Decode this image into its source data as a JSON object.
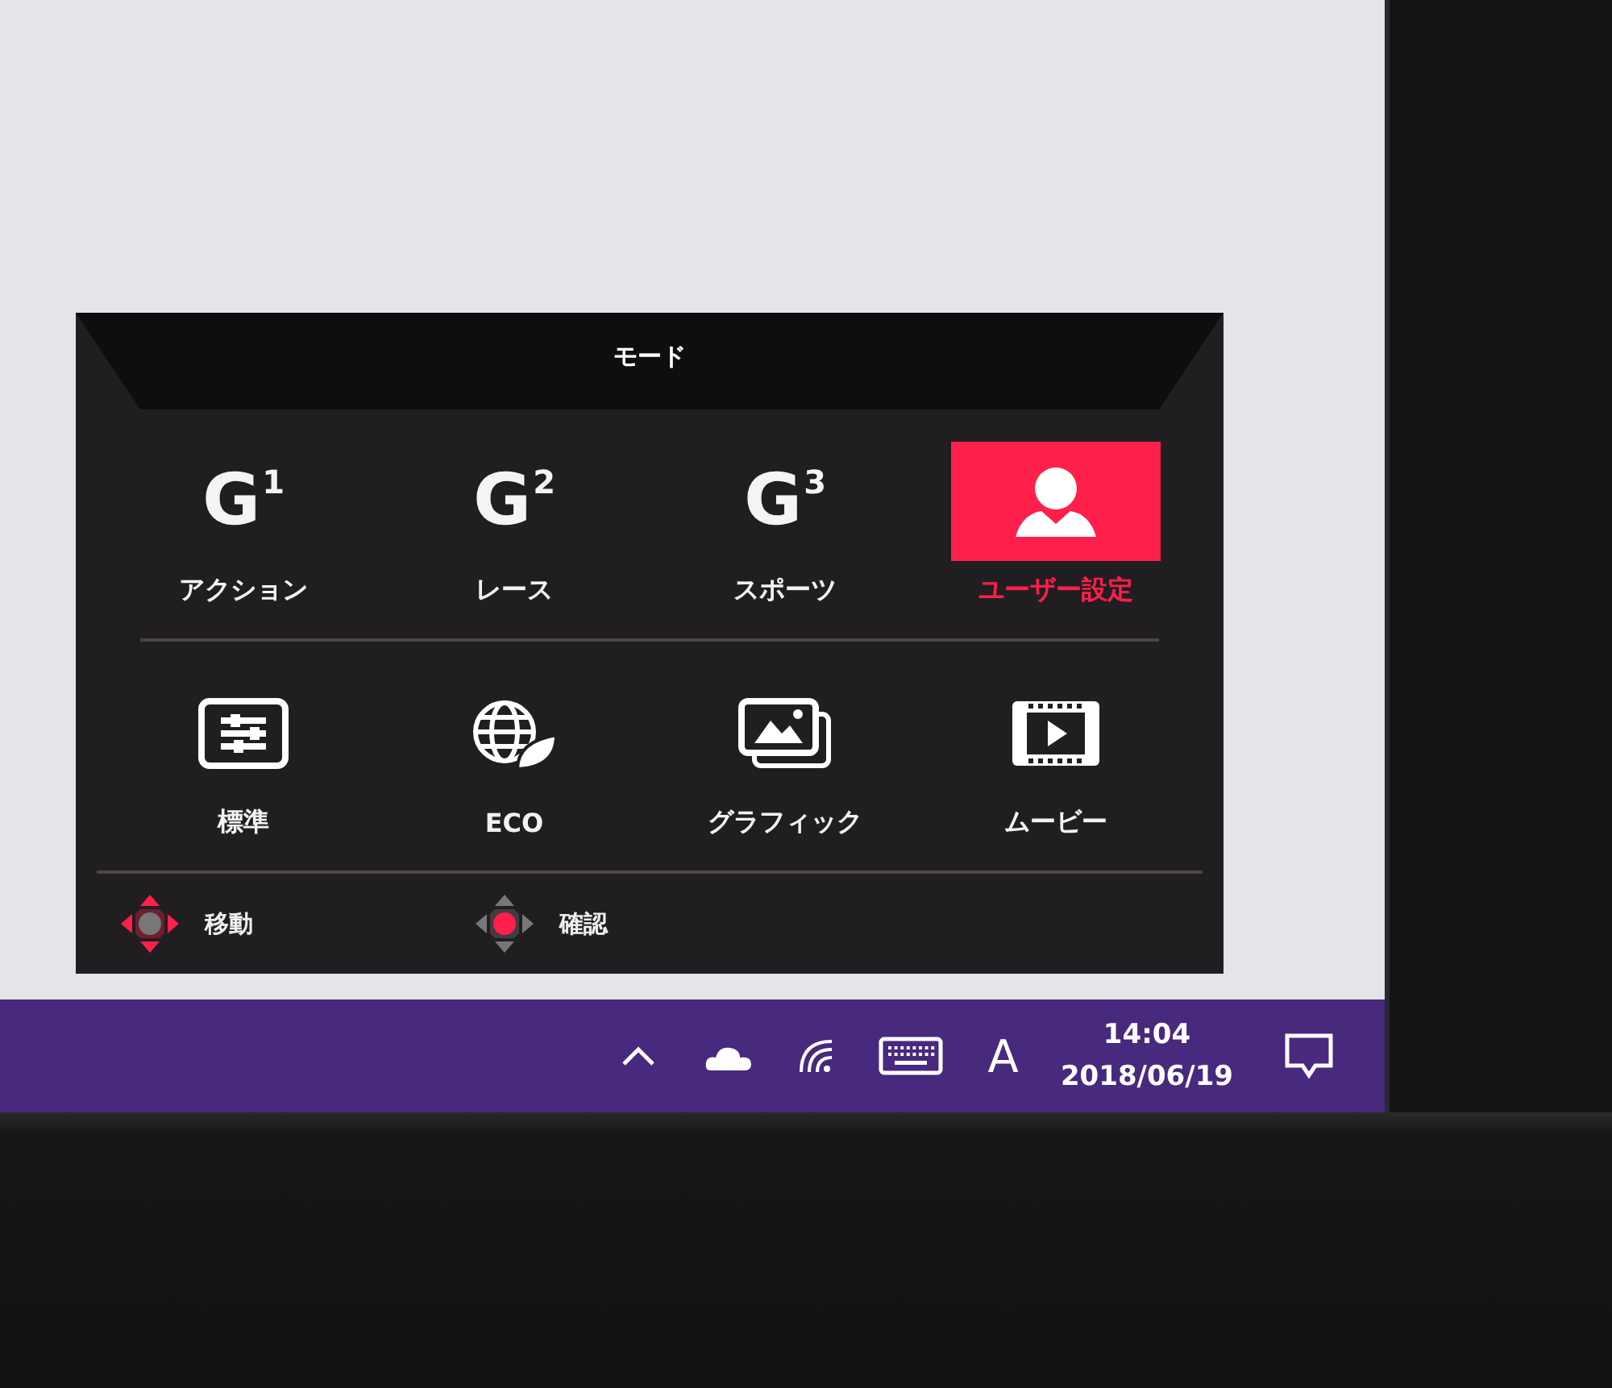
{
  "osd": {
    "title": "モード",
    "modes": [
      {
        "kind": "game",
        "badge": "G",
        "number": "1",
        "label": "アクション",
        "selected": false
      },
      {
        "kind": "game",
        "badge": "G",
        "number": "2",
        "label": "レース",
        "selected": false
      },
      {
        "kind": "game",
        "badge": "G",
        "number": "3",
        "label": "スポーツ",
        "selected": false
      },
      {
        "kind": "user",
        "label": "ユーザー設定",
        "selected": true
      },
      {
        "kind": "standard",
        "label": "標準",
        "selected": false
      },
      {
        "kind": "eco",
        "label": "ECO",
        "selected": false
      },
      {
        "kind": "graphic",
        "label": "グラフィック",
        "selected": false
      },
      {
        "kind": "movie",
        "label": "ムービー",
        "selected": false
      }
    ],
    "hints": [
      {
        "kind": "move",
        "label": "移動"
      },
      {
        "kind": "confirm",
        "label": "確認"
      }
    ]
  },
  "taskbar": {
    "input_indicator": "A",
    "time": "14:04",
    "date": "2018/06/19"
  }
}
